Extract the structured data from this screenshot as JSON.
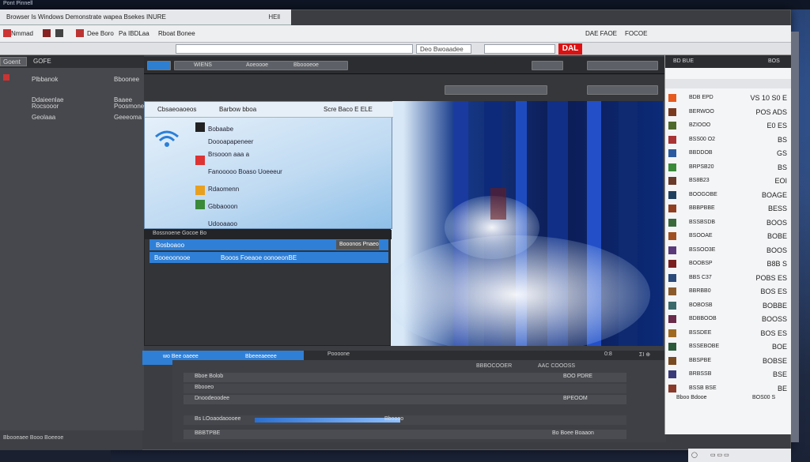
{
  "window": {
    "title": "Pont Pinnell"
  },
  "tab": {
    "title": "Browser Is Windows Demonstrate wapea Bsekes INURE",
    "close_label": "HEll"
  },
  "menubar": {
    "items": [
      "Nmmad",
      "Dee Boro",
      "Pa IBDLaa",
      "Rboat Bonee"
    ],
    "right_items": [
      "DAE FAOE",
      "FOCOE"
    ]
  },
  "urlbar": {
    "address": "",
    "right_field": "Deo Bwoaadee",
    "badge": "DAL"
  },
  "left_panel": {
    "header": "Goent",
    "header_value": "GOFE",
    "rows": [
      {
        "label": "Plbbanok",
        "value": "Bboonee"
      },
      {
        "label": "Ddaieenlae",
        "value": "Baaee"
      },
      {
        "label": "Rocsooor",
        "value": "Poosmone"
      },
      {
        "label": "Geolaaa",
        "value": "Geeeoma"
      }
    ]
  },
  "player_toolbar": {
    "items": [
      "WIENS",
      "Aoeoooe",
      "Bboooeoe"
    ]
  },
  "dialog": {
    "tabs": [
      "Cbsaeoaoeos",
      "Barbow bboa",
      "Scre Baco E ELE"
    ],
    "rows": [
      "Bobaabe",
      "Doooapapeneer",
      "Brsooon aaa a",
      "Fanooooo Boaso Uoeeeur",
      "Rdaomenn",
      "Gbbaooon",
      "Udooaaoo"
    ]
  },
  "dropdown": {
    "header": "Bossnoene Gocoe Bo",
    "options": [
      {
        "label": "Bosboaoo",
        "value": "Booonos Pnaeo"
      },
      {
        "label": "Booeoonooe",
        "value": "Booos Foeaoe oonoeonBE"
      }
    ]
  },
  "bottom_blue": {
    "left": "wo Bee oaeee",
    "right": "Bbeeeaeeee"
  },
  "seekbar": {
    "label": "Poooone",
    "time_left": "0:8",
    "time_right": "ΣΙ ⊕"
  },
  "playlist": {
    "header": [
      "BBBOCOOER",
      "AAC COOOSS"
    ],
    "rows": [
      {
        "label": "Bboe Bolob",
        "value": "BOO PDRE",
        "progress": 0.0
      },
      {
        "label": "Bbooeo",
        "value": "",
        "progress": 0.0
      },
      {
        "label": "Dnoodeoodee",
        "value": "BPEOOM",
        "progress": 0.0
      },
      {
        "label": "Bs LOoaodaoooee",
        "value": "Bboooo",
        "progress": 0.72
      },
      {
        "label": "BBBTPBE",
        "value": "Bo Boee Boaaon",
        "progress": 0.0
      }
    ]
  },
  "right_panel": {
    "header": "BD BUE",
    "header_value": "BOS",
    "items": [
      {
        "name": "BDB EPD",
        "value": "VS 10\nS0 E",
        "color": "#e65a1e"
      },
      {
        "name": "BERWOO",
        "value": "POS ADS",
        "color": "#7a3a20"
      },
      {
        "name": "BZIOOO",
        "value": "E0 ES",
        "color": "#4e6a2a"
      },
      {
        "name": "BSS00 O2",
        "value": "BS",
        "color": "#a33"
      },
      {
        "name": "BBDDOB",
        "value": "GS",
        "color": "#2b5aa0"
      },
      {
        "name": "BRPSB20",
        "value": "BS",
        "color": "#3a8a3a"
      },
      {
        "name": "BS8B23",
        "value": "EOI",
        "color": "#6a3a2a"
      },
      {
        "name": "BOOGOBE",
        "value": "BOAGE",
        "color": "#204060"
      },
      {
        "name": "BBBPBBE",
        "value": "BESS",
        "color": "#904020"
      },
      {
        "name": "BSSBSDB",
        "value": "BOOS",
        "color": "#3a6a3a"
      },
      {
        "name": "BSOOAE",
        "value": "BOBE",
        "color": "#a05020"
      },
      {
        "name": "BSSOO3E",
        "value": "BOOS",
        "color": "#5a3a7a"
      },
      {
        "name": "BOOBSP",
        "value": "B8B S",
        "color": "#7a2020"
      },
      {
        "name": "BBS C37",
        "value": "POBS ES",
        "color": "#2a4a7a"
      },
      {
        "name": "BBRBB0",
        "value": "BOS ES",
        "color": "#8a5a2a"
      },
      {
        "name": "BOBOSB",
        "value": "BOBBE",
        "color": "#3a6a6a"
      },
      {
        "name": "BDBBOOB",
        "value": "BOOSS",
        "color": "#6a2a4a"
      },
      {
        "name": "BSSDEE",
        "value": "BOS ES",
        "color": "#a06a20"
      },
      {
        "name": "BSSEBOBE",
        "value": "BOE",
        "color": "#2a5a3a"
      },
      {
        "name": "BBSPBE",
        "value": "BOBSE",
        "color": "#7a4a20"
      },
      {
        "name": "BRBSSB",
        "value": "BSE",
        "color": "#3a3a7a"
      },
      {
        "name": "BSSB BSE",
        "value": "BE",
        "color": "#8a3a2a"
      }
    ],
    "footer": [
      "Bboo Bdooe",
      "BOS00 S"
    ]
  },
  "statusbar": {
    "text": "Bbooeaee Booo Boeeoe"
  }
}
